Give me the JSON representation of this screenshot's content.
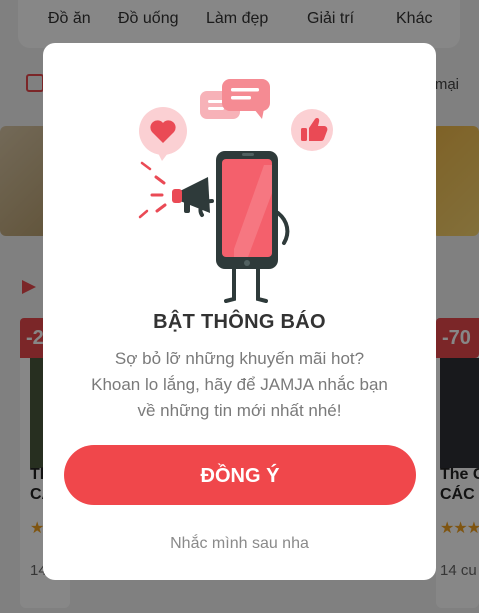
{
  "categories": [
    "Đồ ăn",
    "Đồ uống",
    "Làm đẹp",
    "Giải trí",
    "Khác"
  ],
  "promo_row": {
    "right_text": "mại"
  },
  "cards": [
    {
      "discount": "-2",
      "title_line1": "Th",
      "title_line2": "CÁ",
      "meta": "14"
    },
    {
      "discount": "-70",
      "title_line1": "The C",
      "title_line2": "CÁC",
      "meta": "14 cu"
    }
  ],
  "modal": {
    "title": "BẬT THÔNG BÁO",
    "body_lines": [
      "Sợ bỏ lỡ những khuyến mãi hot?",
      "Khoan lo lắng, hãy để JAMJA nhắc bạn",
      "về những tin mới nhất nhé!"
    ],
    "agree_label": "ĐỒNG Ý",
    "later_label": "Nhắc mình sau nha"
  },
  "colors": {
    "accent": "#f0474b",
    "overlay": "rgba(0,0,0,0.47)"
  }
}
